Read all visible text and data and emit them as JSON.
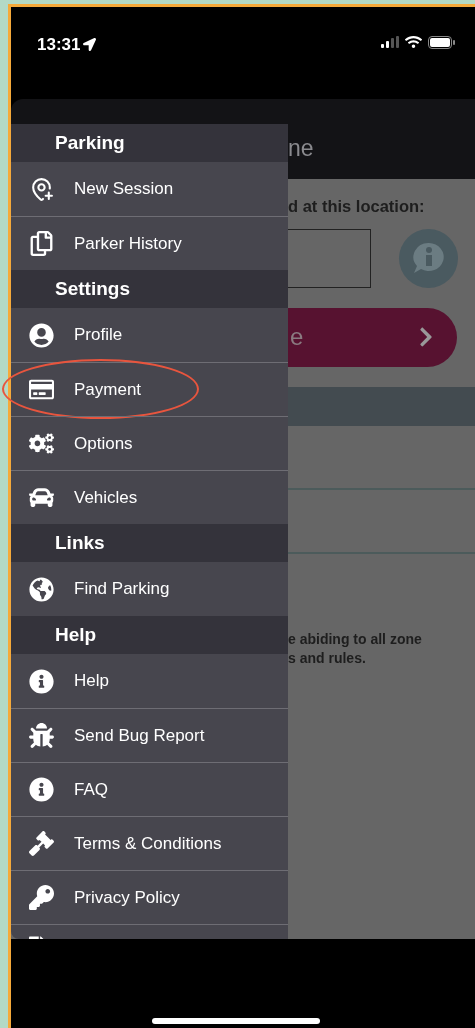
{
  "status_bar": {
    "time": "13:31"
  },
  "background": {
    "header_title": "ne",
    "location_label": "d at this location:",
    "action_button": "e",
    "notice": [
      "e abiding to all zone",
      "s and rules."
    ]
  },
  "drawer": {
    "sections": [
      {
        "title": "Parking",
        "items": [
          {
            "label": "New Session",
            "circled": false
          },
          {
            "label": "Parker History",
            "circled": false
          }
        ]
      },
      {
        "title": "Settings",
        "items": [
          {
            "label": "Profile",
            "circled": false
          },
          {
            "label": "Payment",
            "circled": true
          },
          {
            "label": "Options",
            "circled": false
          },
          {
            "label": "Vehicles",
            "circled": false
          }
        ]
      },
      {
        "title": "Links",
        "items": [
          {
            "label": "Find Parking",
            "circled": false
          }
        ]
      },
      {
        "title": "Help",
        "items": [
          {
            "label": "Help",
            "circled": false
          },
          {
            "label": "Send Bug Report",
            "circled": false
          },
          {
            "label": "FAQ",
            "circled": false
          },
          {
            "label": "Terms & Conditions",
            "circled": false
          },
          {
            "label": "Privacy Policy",
            "circled": false
          }
        ]
      }
    ]
  }
}
